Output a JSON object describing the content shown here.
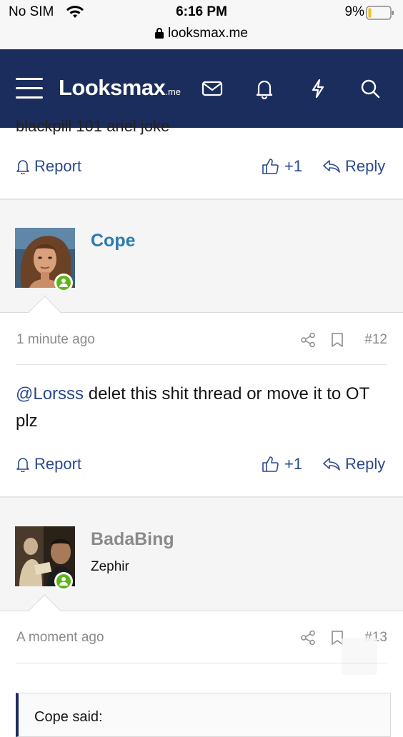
{
  "status_bar": {
    "carrier": "No SIM",
    "time": "6:16 PM",
    "battery": "9%",
    "url": "looksmax.me"
  },
  "header": {
    "logo_main": "Looksmax",
    "logo_suffix": ".me",
    "icons": [
      "menu-icon",
      "mail-icon",
      "bell-icon",
      "bolt-icon",
      "search-icon"
    ]
  },
  "prev_post": {
    "cut_text": "blackpill 101 ariel joke",
    "report_label": "Report",
    "like_label": "+1",
    "reply_label": "Reply"
  },
  "posts": [
    {
      "username": "Cope",
      "user_title": "",
      "time": "1 minute ago",
      "number": "#12",
      "mention": "@Lorsss",
      "message": " delet this shit thread or move it to OT plz",
      "report_label": "Report",
      "like_label": "+1",
      "reply_label": "Reply"
    },
    {
      "username": "BadaBing",
      "user_title": "Zephir",
      "time": "A moment ago",
      "number": "#13",
      "quote_author": "Cope said:"
    }
  ],
  "colors": {
    "header_bg": "#1b2d5c",
    "link": "#2a4a8c",
    "username_cope": "#2b7bb0",
    "username_badabing": "#8a8a8a",
    "online": "#5cb617"
  }
}
